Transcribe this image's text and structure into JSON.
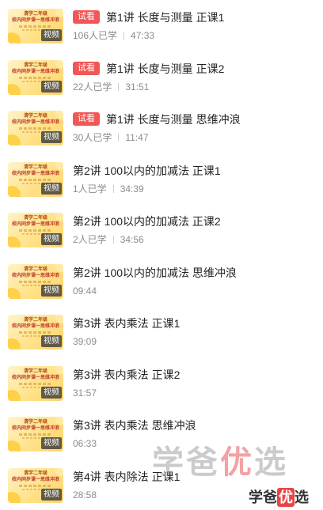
{
  "thumbnail": {
    "line1": "清学二年级",
    "line2": "校内同步课一思维冲浪",
    "video_tag": "视频"
  },
  "lessons": [
    {
      "badge": "试看",
      "title": "第1讲 长度与测量 正课1",
      "learners": "106人已学",
      "duration": "47:33"
    },
    {
      "badge": "试看",
      "title": "第1讲 长度与测量 正课2",
      "learners": "22人已学",
      "duration": "31:51"
    },
    {
      "badge": "试看",
      "title": "第1讲 长度与测量 思维冲浪",
      "learners": "30人已学",
      "duration": "11:47"
    },
    {
      "badge": "",
      "title": "第2讲 100以内的加减法 正课1",
      "learners": "1人已学",
      "duration": "34:39"
    },
    {
      "badge": "",
      "title": "第2讲 100以内的加减法 正课2",
      "learners": "2人已学",
      "duration": "34:56"
    },
    {
      "badge": "",
      "title": "第2讲 100以内的加减法 思维冲浪",
      "learners": "",
      "duration": "09:44"
    },
    {
      "badge": "",
      "title": "第3讲 表内乘法 正课1",
      "learners": "",
      "duration": "39:09"
    },
    {
      "badge": "",
      "title": "第3讲 表内乘法 正课2",
      "learners": "",
      "duration": "31:57"
    },
    {
      "badge": "",
      "title": "第3讲 表内乘法 思维冲浪",
      "learners": "",
      "duration": "06:33"
    },
    {
      "badge": "",
      "title": "第4讲 表内除法 正课1",
      "learners": "",
      "duration": "28:58"
    }
  ],
  "watermark": {
    "part1": "学爸",
    "highlight": "优",
    "part2": "选"
  },
  "colors": {
    "badge_bg": "#f25656",
    "title": "#222222",
    "meta": "#8c8c8c",
    "watermark_highlight": "#e84646"
  }
}
